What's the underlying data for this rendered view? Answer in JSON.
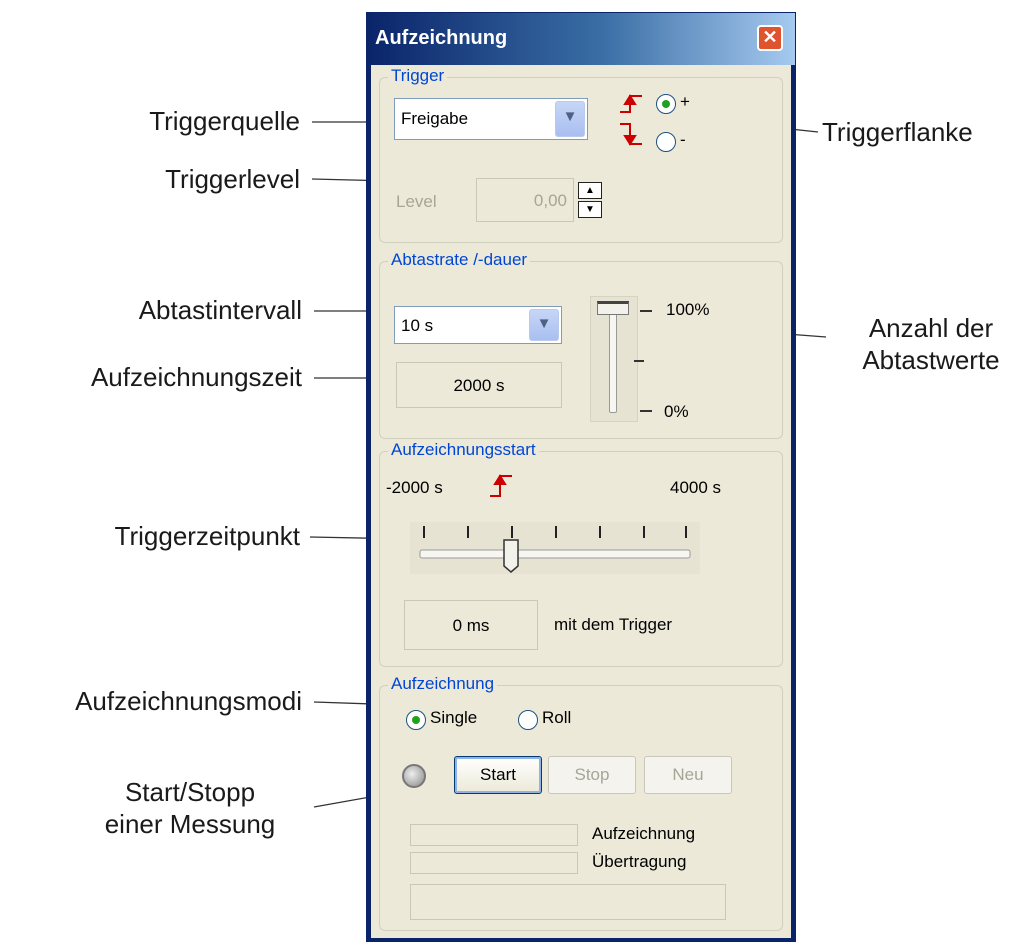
{
  "callouts": {
    "triggerquelle": "Triggerquelle",
    "triggerflanke": "Triggerflanke",
    "triggerlevel": "Triggerlevel",
    "abtastintervall": "Abtastintervall",
    "anzahl_line1": "Anzahl der",
    "anzahl_line2": "Abtastwerte",
    "aufzeichnungszeit": "Aufzeichnungszeit",
    "triggerzeitpunkt": "Triggerzeitpunkt",
    "aufzeichnungsmodi": "Aufzeichnungsmodi",
    "startstopp_line1": "Start/Stopp",
    "startstopp_line2": "einer Messung"
  },
  "window": {
    "title": "Aufzeichnung",
    "close_glyph": "✕"
  },
  "trigger": {
    "legend": "Trigger",
    "source_value": "Freigabe",
    "edge_plus": "+",
    "edge_minus": "-",
    "edge_selected": "+",
    "level_label": "Level",
    "level_value": "0,00"
  },
  "sampling": {
    "legend": "Abtastrate /-dauer",
    "interval_value": "10 s",
    "duration_value": "2000 s",
    "slider_max_label": "100%",
    "slider_min_label": "0%",
    "slider_level": 1.0
  },
  "record_start": {
    "legend": "Aufzeichnungsstart",
    "min_label": "-2000 s",
    "max_label": "4000 s",
    "offset_value": "0 ms",
    "offset_suffix": "mit dem Trigger",
    "slider_position": 0.333
  },
  "recording": {
    "legend": "Aufzeichnung",
    "mode_single": "Single",
    "mode_roll": "Roll",
    "mode_selected": "Single",
    "start_label": "Start",
    "stop_label": "Stop",
    "new_label": "Neu",
    "progress_record_label": "Aufzeichnung",
    "progress_transfer_label": "Übertragung"
  },
  "colors": {
    "accent": "#0a246a",
    "legend": "#0046d5",
    "trigger_red": "#cc0000",
    "client_bg": "#ece9d8"
  }
}
